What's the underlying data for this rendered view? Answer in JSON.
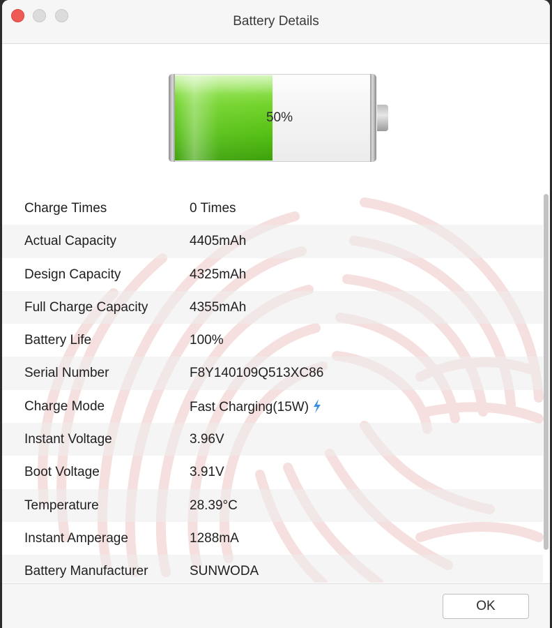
{
  "window": {
    "title": "Battery Details"
  },
  "battery": {
    "percent_label": "50%",
    "level": 0.5,
    "fill_color": "#55bf14"
  },
  "details": [
    {
      "label": "Charge Times",
      "value": "0 Times"
    },
    {
      "label": "Actual Capacity",
      "value": "4405mAh"
    },
    {
      "label": "Design Capacity",
      "value": "4325mAh"
    },
    {
      "label": "Full Charge Capacity",
      "value": "4355mAh"
    },
    {
      "label": "Battery Life",
      "value": "100%"
    },
    {
      "label": "Serial Number",
      "value": "F8Y140109Q513XC86"
    },
    {
      "label": "Charge Mode",
      "value": "Fast Charging(15W)",
      "icon": "lightning-bolt-icon"
    },
    {
      "label": "Instant Voltage",
      "value": "3.96V"
    },
    {
      "label": "Boot Voltage",
      "value": "3.91V"
    },
    {
      "label": "Temperature",
      "value": "28.39°C"
    },
    {
      "label": "Instant Amperage",
      "value": "1288mA"
    },
    {
      "label": "Battery Manufacturer",
      "value": "SUNWODA"
    }
  ],
  "footer": {
    "ok_label": "OK"
  },
  "colors": {
    "accent_bolt": "#3b8fe0",
    "watermark": "#e9bcbc"
  }
}
